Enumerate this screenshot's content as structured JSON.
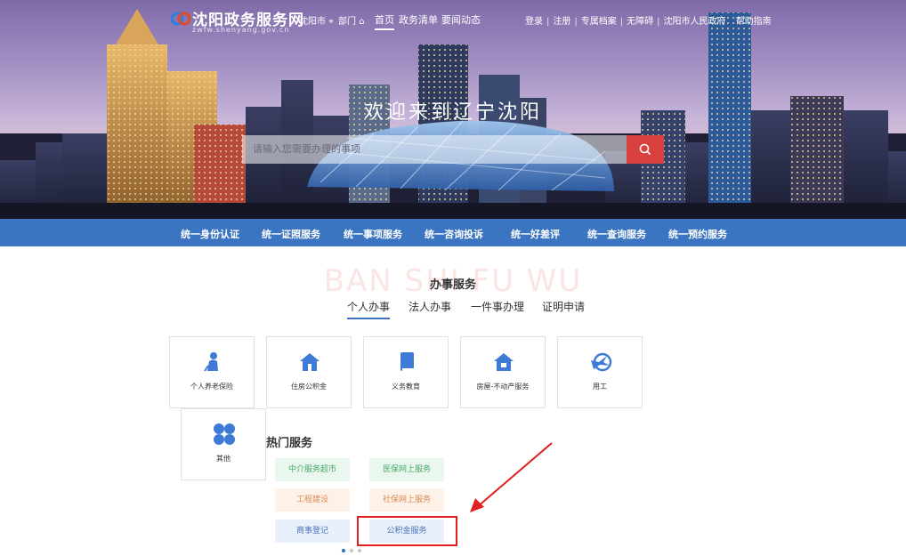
{
  "header": {
    "site_title": "沈阳政务服务网",
    "site_domain": "zwfw.shenyang.gov.cn",
    "location_city": "沈阳市",
    "location_dept": "部门",
    "nav": [
      "首页",
      "政务清单",
      "要闻动态"
    ],
    "right_links": [
      "登录",
      "注册",
      "专属档案",
      "无障碍",
      "沈阳市人民政府",
      "帮助指南"
    ]
  },
  "hero": {
    "welcome": "欢迎来到辽宁沈阳",
    "search_placeholder": "请输入您需要办理的事项"
  },
  "bluebar": {
    "items": [
      "统一身份认证",
      "统一证照服务",
      "统一事项服务",
      "统一咨询投诉",
      "统一好差评",
      "统一查询服务",
      "统一预约服务"
    ]
  },
  "services": {
    "watermark": "BAN SHI FU WU",
    "title": "办事服务",
    "tabs": [
      "个人办事",
      "法人办事",
      "一件事办理",
      "证明申请"
    ],
    "active_tab": "个人办事",
    "tiles": [
      {
        "label": "个人养老保险",
        "icon": "elderly-icon"
      },
      {
        "label": "住房公积金",
        "icon": "house-icon"
      },
      {
        "label": "义务教育",
        "icon": "book-icon"
      },
      {
        "label": "房屋-不动产服务",
        "icon": "property-icon"
      },
      {
        "label": "用工",
        "icon": "worker-icon"
      },
      {
        "label": "其他",
        "icon": "grid-icon"
      }
    ]
  },
  "hot": {
    "title": "热门服务",
    "items": [
      "中介服务超市",
      "医保网上服务",
      "工程建设",
      "社保网上服务",
      "商事登记",
      "公积金服务"
    ]
  },
  "colors": {
    "accent_blue": "#3b74c0",
    "search_red": "#d9413e",
    "highlight_red": "#e02020",
    "icon_blue": "#3f7bd6"
  }
}
